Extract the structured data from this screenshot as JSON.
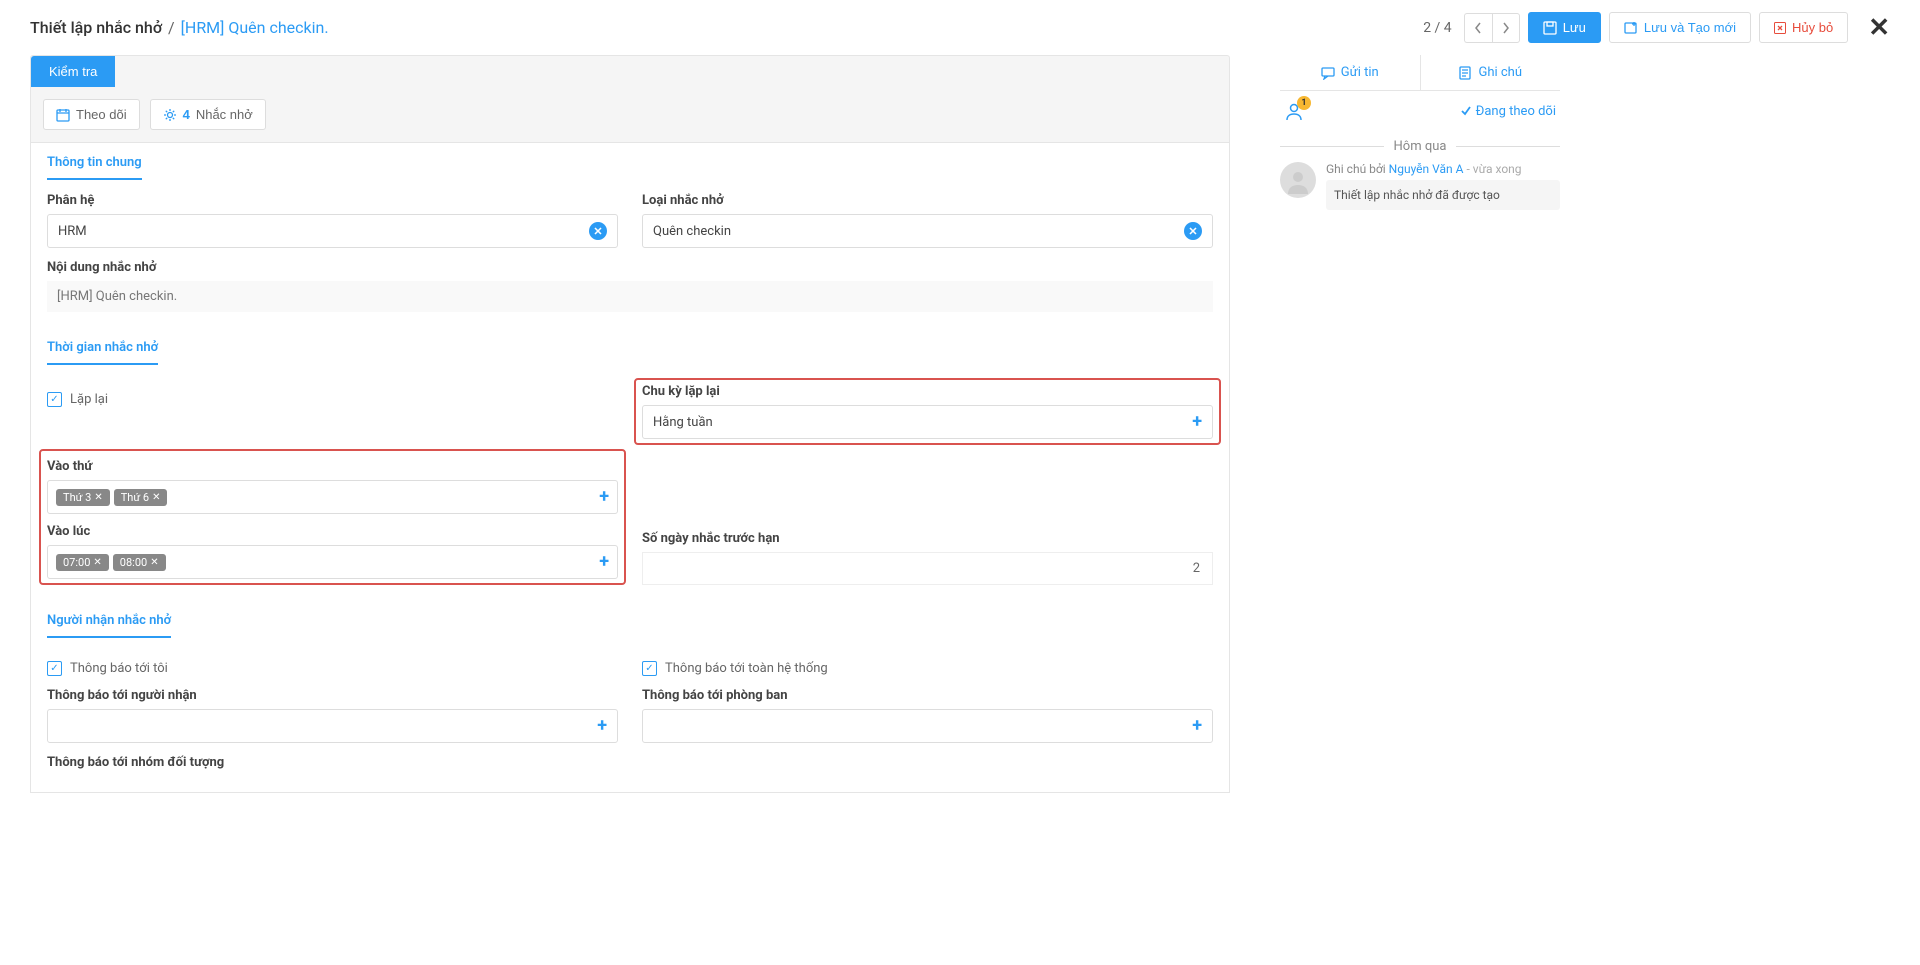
{
  "header": {
    "breadcrumb_title": "Thiết lập nhắc nhở",
    "breadcrumb_current": "[HRM] Quên checkin.",
    "page_counter": "2 / 4",
    "save": "Lưu",
    "save_new": "Lưu và Tạo mới",
    "cancel": "Hủy bỏ"
  },
  "toolbar": {
    "check": "Kiểm tra",
    "follow": "Theo dõi",
    "reminder_count": "4",
    "reminder_label": "Nhắc nhở"
  },
  "sections": {
    "general": "Thông tin chung",
    "time": "Thời gian nhắc nhở",
    "recipients": "Người nhận nhắc nhở"
  },
  "form": {
    "module_label": "Phân hệ",
    "module_value": "HRM",
    "type_label": "Loại nhắc nhở",
    "type_value": "Quên checkin",
    "content_label": "Nội dung nhắc nhở",
    "content_value": "[HRM] Quên checkin.",
    "repeat_label": "Lặp lại",
    "cycle_label": "Chu kỳ lặp lại",
    "cycle_value": "Hằng tuần",
    "weekday_label": "Vào thứ",
    "weekday_tags": [
      "Thứ 3",
      "Thứ 6"
    ],
    "time_label": "Vào lúc",
    "time_tags": [
      "07:00",
      "08:00"
    ],
    "days_before_label": "Số ngày nhắc trước hạn",
    "days_before_value": "2",
    "notify_me_label": "Thông báo tới tôi",
    "notify_system_label": "Thông báo tới toàn hệ thống",
    "notify_recipients_label": "Thông báo tới người nhận",
    "notify_dept_label": "Thông báo tới phòng ban",
    "notify_group_label": "Thông báo tới nhóm đối tượng"
  },
  "side": {
    "send_tab": "Gửi tin",
    "note_tab": "Ghi chú",
    "badge": "1",
    "following": "Đang theo dõi",
    "day_label": "Hôm qua",
    "log_prefix": "Ghi chú bởi ",
    "log_user": "Nguyễn Văn A",
    "log_time_sep": " - ",
    "log_time": "vừa xong",
    "log_message": "Thiết lập nhắc nhở đã được tạo"
  }
}
